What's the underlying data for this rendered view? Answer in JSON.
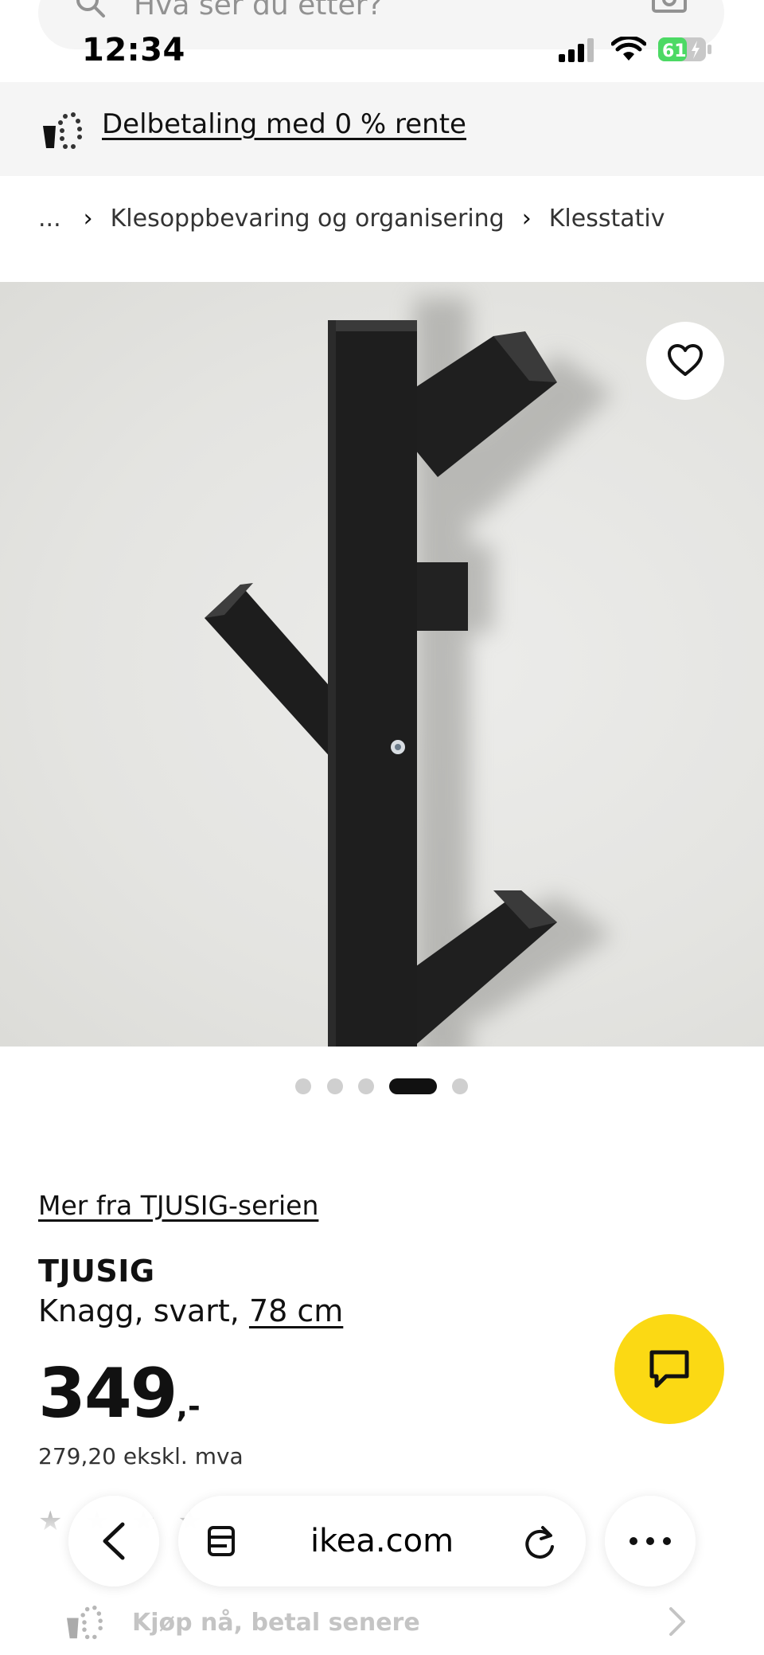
{
  "search": {
    "placeholder": "Hva ser du etter?"
  },
  "status_bar": {
    "time": "12:34",
    "battery": "61"
  },
  "promo": {
    "text": "Delbetaling med 0 % rente"
  },
  "breadcrumb": {
    "ellipsis": "...",
    "items": [
      "Klesoppbevaring og organisering",
      "Klesstativ"
    ]
  },
  "carousel": {
    "total": 5,
    "active_index": 3
  },
  "product": {
    "series_link": "Mer fra TJUSIG-serien",
    "name": "TJUSIG",
    "description": "Knagg, svart, ",
    "size_link": "78 cm",
    "price": "349",
    "price_suffix": ",-",
    "price_ex_vat": "279,20 ekskl. mva"
  },
  "browser": {
    "url": "ikea.com"
  },
  "bnpl": {
    "text": "Kjøp nå, betal senere"
  },
  "colors": {
    "ikea_yellow": "#fbd914",
    "text": "#111111",
    "banner_bg": "#f5f5f5",
    "battery_green": "#4cd964"
  }
}
